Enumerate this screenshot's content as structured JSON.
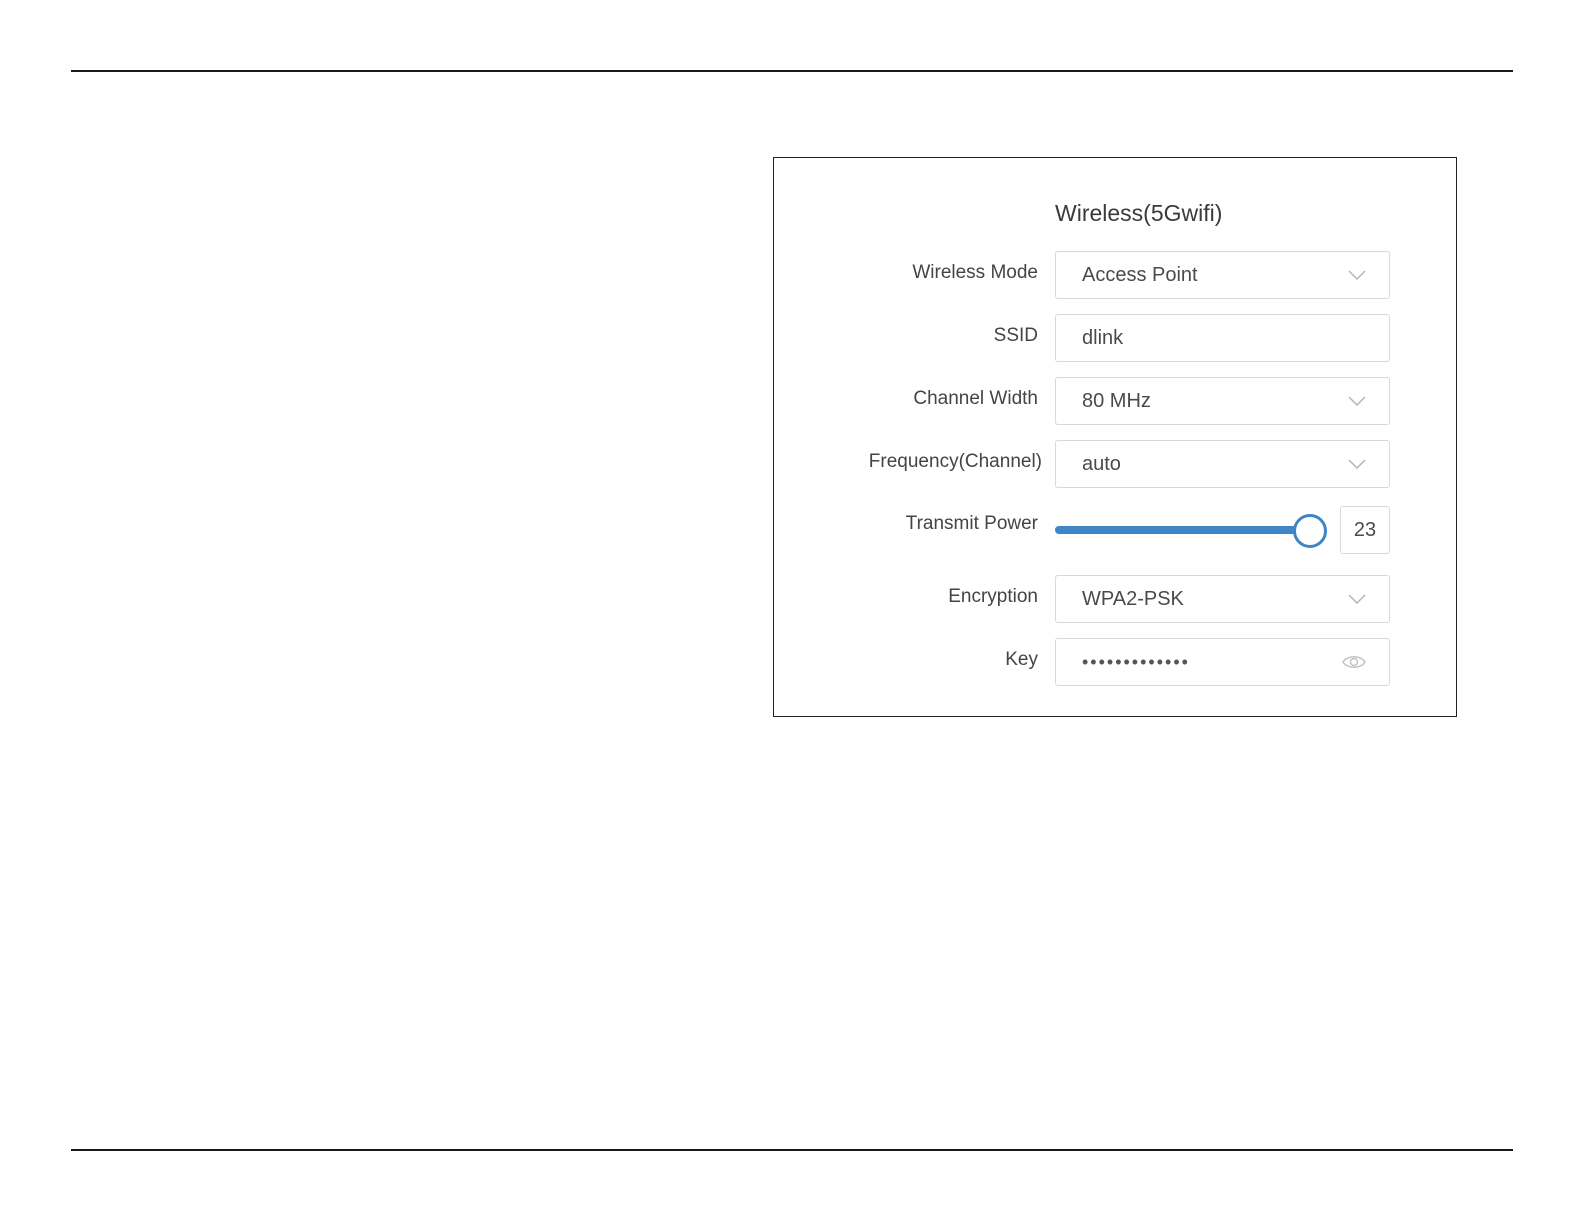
{
  "panel": {
    "title": "Wireless(5Gwifi)"
  },
  "rows": {
    "wireless_mode": {
      "label": "Wireless Mode",
      "value": "Access Point",
      "icon": "chevron-down-icon"
    },
    "ssid": {
      "label": "SSID",
      "value": "dlink"
    },
    "channel_width": {
      "label": "Channel Width",
      "value": "80 MHz",
      "icon": "chevron-down-icon"
    },
    "frequency": {
      "label": "Frequency(Channel)",
      "value": "auto",
      "icon": "chevron-down-icon"
    },
    "transmit_power": {
      "label": "Transmit Power",
      "value": "23",
      "level_fraction": 0.94
    },
    "encryption": {
      "label": "Encryption",
      "value": "WPA2-PSK",
      "icon": "chevron-down-icon"
    },
    "key": {
      "label": "Key",
      "value": "•••••••••••••",
      "icon": "eye-icon"
    }
  },
  "colors": {
    "accent": "#3f86c8",
    "border": "#d9d9d9",
    "text": "#4a4a4a"
  }
}
